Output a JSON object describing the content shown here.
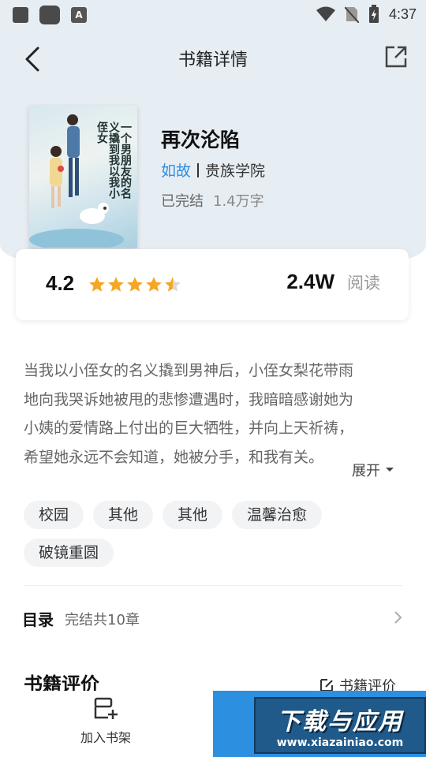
{
  "status_bar": {
    "time": "4:37",
    "app_icon_letter": "A"
  },
  "header": {
    "title": "书籍详情"
  },
  "book": {
    "cover_title": "一个男朋友的名义撬到我以我小侄女",
    "title": "再次沦陷",
    "author": "如故",
    "category": "贵族学院",
    "status": "已完结",
    "word_count": "1.4万字"
  },
  "rating": {
    "score": "4.2",
    "stars": 4.5,
    "reads": "2.4W",
    "reads_label": "阅读",
    "star_color": "#f5a623"
  },
  "description": {
    "lines": [
      "当我以小侄女的名义撬到男神后，小侄女梨花带雨",
      "地向我哭诉她被甩的悲惨遭遇时，我暗暗感谢她为",
      "小姨的爱情路上付出的巨大牺牲，并向上天祈祷，",
      "希望她永远不会知道，她被分手，和我有关。"
    ],
    "expand_label": "展开"
  },
  "tags": [
    "校园",
    "其他",
    "其他",
    "温馨治愈",
    "破镜重圆"
  ],
  "toc": {
    "label": "目录",
    "info": "完结共10章"
  },
  "reviews": {
    "title": "书籍评价",
    "link_label": "书籍评价"
  },
  "bottom_bar": {
    "shelf_label": "加入书架",
    "accent": "#2d8fe0"
  },
  "watermark": {
    "line1": "下载与应用",
    "line2": "www.xiazainiao.com"
  }
}
